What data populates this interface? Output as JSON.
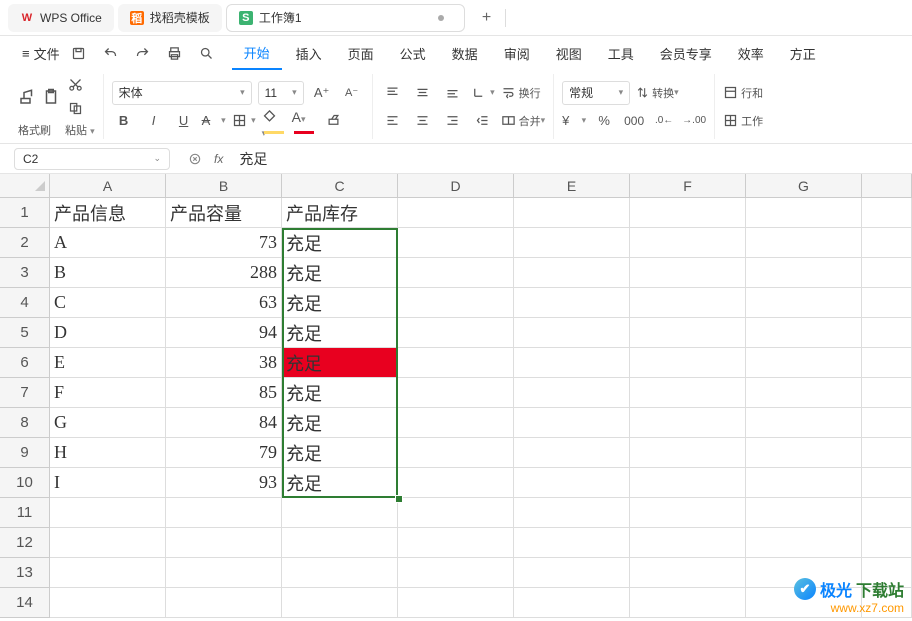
{
  "titlebar": {
    "tabs": [
      {
        "icon": "W",
        "label": "WPS Office"
      },
      {
        "icon": "稻",
        "label": "找稻壳模板"
      },
      {
        "icon": "S",
        "label": "工作簿1"
      }
    ],
    "add": "+"
  },
  "menubar": {
    "file_icon": "≡",
    "file_label": "文件",
    "left_icons": [
      "undo-icon",
      "redo-icon",
      "print-icon",
      "qsearch-icon"
    ],
    "items": [
      "开始",
      "插入",
      "页面",
      "公式",
      "数据",
      "审阅",
      "视图",
      "工具",
      "会员专享",
      "效率",
      "方正"
    ]
  },
  "toolbar": {
    "format_painter": "格式刷",
    "paste": "粘贴",
    "font_name": "宋体",
    "font_size": "11",
    "wrap": "换行",
    "merge": "合并",
    "number_format": "常规",
    "convert": "转换",
    "row_col": "行和",
    "worksheet": "工作"
  },
  "formula": {
    "name_box": "C2",
    "fx": "fx",
    "value": "充足"
  },
  "grid": {
    "columns": [
      "A",
      "B",
      "C",
      "D",
      "E",
      "F",
      "G"
    ],
    "header_row": [
      "产品信息",
      "产品容量",
      "产品库存"
    ],
    "rows": [
      {
        "n": "1"
      },
      {
        "n": "2",
        "a": "A",
        "b": "73",
        "c": "充足"
      },
      {
        "n": "3",
        "a": "B",
        "b": "288",
        "c": "充足"
      },
      {
        "n": "4",
        "a": "C",
        "b": "63",
        "c": "充足"
      },
      {
        "n": "5",
        "a": "D",
        "b": "94",
        "c": "充足"
      },
      {
        "n": "6",
        "a": "E",
        "b": "38",
        "c": "充足",
        "red": true
      },
      {
        "n": "7",
        "a": "F",
        "b": "85",
        "c": "充足"
      },
      {
        "n": "8",
        "a": "G",
        "b": "84",
        "c": "充足"
      },
      {
        "n": "9",
        "a": "H",
        "b": "79",
        "c": "充足"
      },
      {
        "n": "10",
        "a": "I",
        "b": "93",
        "c": "充足"
      },
      {
        "n": "11"
      },
      {
        "n": "12"
      },
      {
        "n": "13"
      },
      {
        "n": "14"
      }
    ]
  },
  "watermark": {
    "brand1": "极光",
    "brand2": "下载站",
    "url": "www.xz7.com"
  },
  "chart_data": {
    "type": "table",
    "title": "",
    "columns": [
      "产品信息",
      "产品容量",
      "产品库存"
    ],
    "rows": [
      [
        "A",
        73,
        "充足"
      ],
      [
        "B",
        288,
        "充足"
      ],
      [
        "C",
        63,
        "充足"
      ],
      [
        "D",
        94,
        "充足"
      ],
      [
        "E",
        38,
        "充足"
      ],
      [
        "F",
        85,
        "充足"
      ],
      [
        "G",
        84,
        "充足"
      ],
      [
        "H",
        79,
        "充足"
      ],
      [
        "I",
        93,
        "充足"
      ]
    ],
    "highlight_rule": "row where 产品容量 < 40 → 产品库存 cell filled red",
    "selected_range": "C2:C10"
  }
}
